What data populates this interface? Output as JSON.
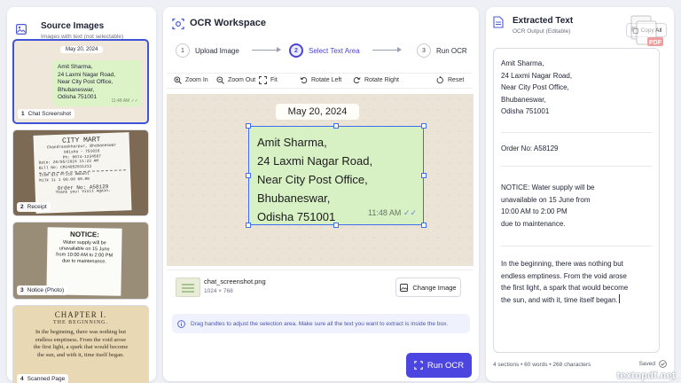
{
  "left_panel": {
    "title": "Source Images",
    "subtitle": "Images with text (not selectable)",
    "thumbs": [
      {
        "num": "1",
        "label": "Chat Screenshot",
        "date": "May 20, 2024",
        "lines": [
          "Amit Sharma,",
          "24 Laxmi Nagar Road,",
          "Near City Post Office,",
          "Bhubaneswar,",
          "Odisha 751001"
        ],
        "time": "11:48 AM"
      },
      {
        "num": "2",
        "label": "Receipt",
        "lines": [
          "CITY MART",
          "Chandrasekharpur, Bhubaneswar",
          "Odisha - 751016",
          "Ph: 0674-1234567",
          "Date: 20/05/2024   11:23 AM",
          "Bill No: CM24052011213",
          "Item        Qty   Price   Amount",
          "Milk 1L      1    60.00    60.00",
          "Order No: A58129",
          "Thank you! Visit Again."
        ]
      },
      {
        "num": "3",
        "label": "Notice (Photo)",
        "heading": "NOTICE:",
        "lines": [
          "Water supply will be",
          "unavailable on 15 June",
          "from 10:00 AM to 2:00 PM",
          "due to maintenance."
        ]
      },
      {
        "num": "4",
        "label": "Scanned Page",
        "heading": "CHAPTER I.",
        "subheading": "THE BEGINNING.",
        "lines": [
          "In the beginning, there was nothing but",
          "endless emptiness. From the void arose",
          "the first light, a spark that would become",
          "the sun, and with it, time itself began."
        ]
      }
    ]
  },
  "workspace": {
    "title": "OCR Workspace",
    "steps": [
      {
        "num": "1",
        "label": "Upload Image"
      },
      {
        "num": "2",
        "label": "Select Text Area"
      },
      {
        "num": "3",
        "label": "Run OCR"
      }
    ],
    "active_step": 2,
    "toolbar": {
      "zoom_in": "Zoom In",
      "zoom_out": "Zoom Out",
      "fit": "Fit",
      "rotate_left": "Rotate Left",
      "rotate_right": "Rotate Right",
      "reset": "Reset"
    },
    "canvas": {
      "date": "May 20, 2024",
      "lines": [
        "Amit Sharma,",
        "24 Laxmi Nagar Road,",
        "Near City Post Office,",
        "Bhubaneswar,",
        "Odisha 751001"
      ],
      "time": "11:48 AM"
    },
    "file": {
      "name": "chat_screenshot.png",
      "size": "1024 × 768",
      "change_label": "Change Image"
    },
    "hint": "Drag handles to adjust the selection area. Make sure all the text you want to extract is inside the box.",
    "run_label": "Run OCR",
    "accent": "#4d45e0"
  },
  "extracted": {
    "title": "Extracted Text",
    "subtitle": "OCR Output (Editable)",
    "copy_label": "Copy All",
    "sections": [
      [
        "Amit Sharma,",
        "24 Laxmi Nagar Road,",
        "Near City Post Office,",
        "Bhubaneswar,",
        "Odisha 751001"
      ],
      [
        "Order No: A58129"
      ],
      [
        "NOTICE: Water supply will be",
        "unavailable on 15 June from",
        "10:00 AM to 2:00 PM",
        "due to maintenance."
      ],
      [
        "In the beginning, there was nothing but",
        "endless emptiness. From the void arose",
        "the first light, a spark that would become",
        "the sun, and with it, time itself began."
      ]
    ],
    "stats": "4 sections • 60 words • 268 characters",
    "status": "Saved"
  },
  "watermark": "textopdf.net"
}
